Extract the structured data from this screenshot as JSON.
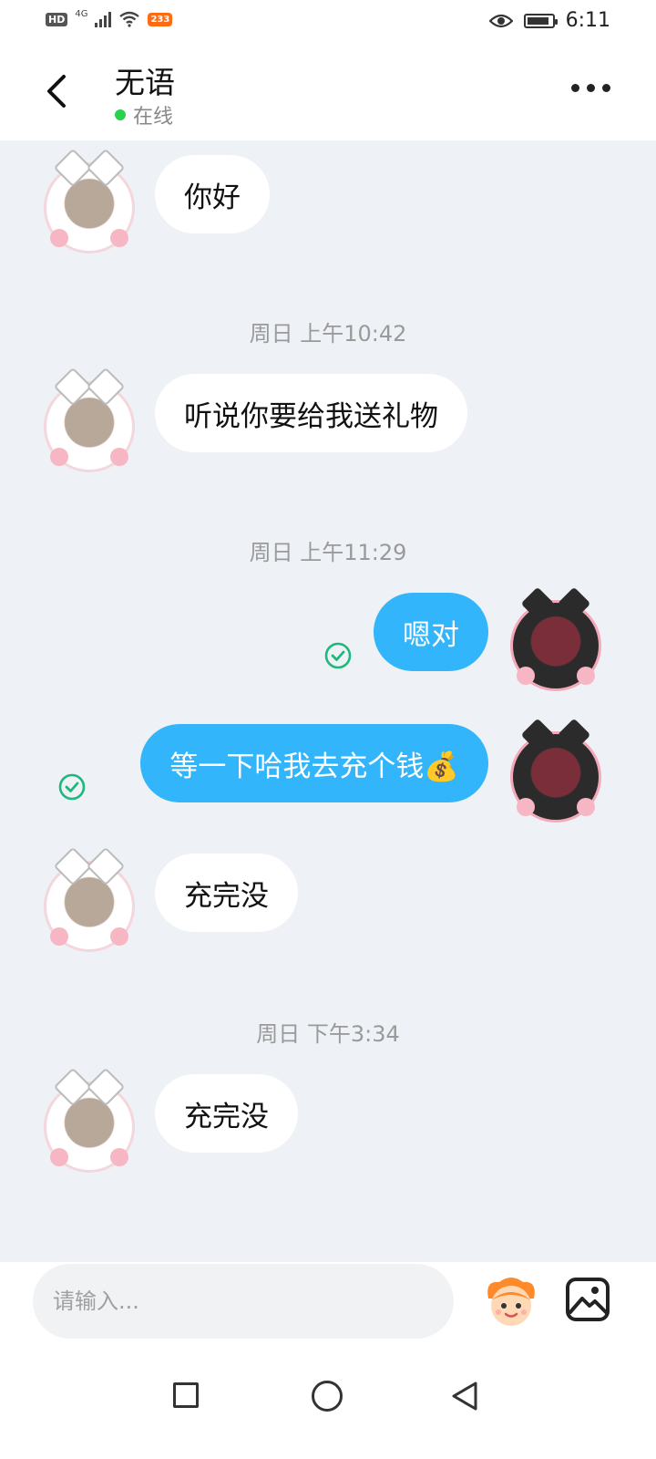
{
  "status_bar": {
    "hd": "HD",
    "network": "4G",
    "app_badge": "233",
    "time": "6:11",
    "battery_level": 0.9,
    "icons": [
      "signal-icon",
      "wifi-icon",
      "eye-icon",
      "battery-icon"
    ]
  },
  "header": {
    "contact_name": "无语",
    "status": "在线",
    "status_color": "#2bd14b",
    "icons": [
      "back-arrow-icon",
      "more-options-icon"
    ]
  },
  "chat": {
    "items": [
      {
        "type": "message",
        "from": "them",
        "text": "你好"
      },
      {
        "type": "timestamp",
        "text": "周日 上午10:42"
      },
      {
        "type": "message",
        "from": "them",
        "text": "听说你要给我送礼物"
      },
      {
        "type": "timestamp",
        "text": "周日 上午11:29"
      },
      {
        "type": "message",
        "from": "me",
        "text": "嗯对",
        "read": true
      },
      {
        "type": "message",
        "from": "me",
        "text": "等一下哈我去充个钱💰",
        "read": true
      },
      {
        "type": "message",
        "from": "them",
        "text": "充完没"
      },
      {
        "type": "timestamp",
        "text": "周日 下午3:34"
      },
      {
        "type": "message",
        "from": "them",
        "text": "充完没"
      }
    ],
    "outgoing_color": "#32b5fb",
    "incoming_color": "#ffffff",
    "read_check_color": "#1eb87a"
  },
  "composer": {
    "placeholder": "请输入...",
    "icons": [
      "emoji-sticker-icon",
      "image-icon"
    ]
  },
  "nav_bar": {
    "icons": [
      "recents-square-icon",
      "home-circle-icon",
      "back-triangle-icon"
    ]
  }
}
